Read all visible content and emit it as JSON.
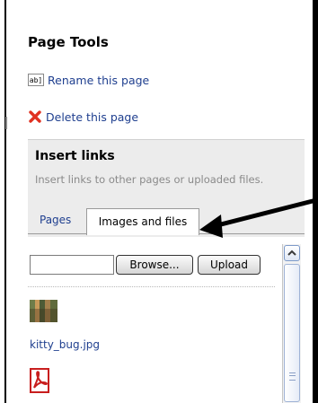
{
  "panel": {
    "title": "Page Tools",
    "rename_label": "Rename this page",
    "rename_icon_text": "ab]",
    "delete_label": "Delete this page"
  },
  "insert_links": {
    "title": "Insert links",
    "description": "Insert links to other pages or uploaded files.",
    "tabs": [
      {
        "label": "Pages",
        "selected": false
      },
      {
        "label": "Images and files",
        "selected": true
      }
    ]
  },
  "upload": {
    "file_value": "",
    "browse_label": "Browse...",
    "upload_label": "Upload"
  },
  "files": [
    {
      "name": "",
      "type": "image-thumbnail"
    },
    {
      "name": "kitty_bug.jpg",
      "type": "link"
    },
    {
      "name": "",
      "type": "pdf-icon"
    }
  ],
  "colors": {
    "link": "#1f3f8f",
    "panel_bg": "#ececec",
    "hint": "#8a8a8a",
    "delete_icon": "#e03020",
    "pdf_red": "#c81e1e",
    "arrow": "#000000"
  }
}
